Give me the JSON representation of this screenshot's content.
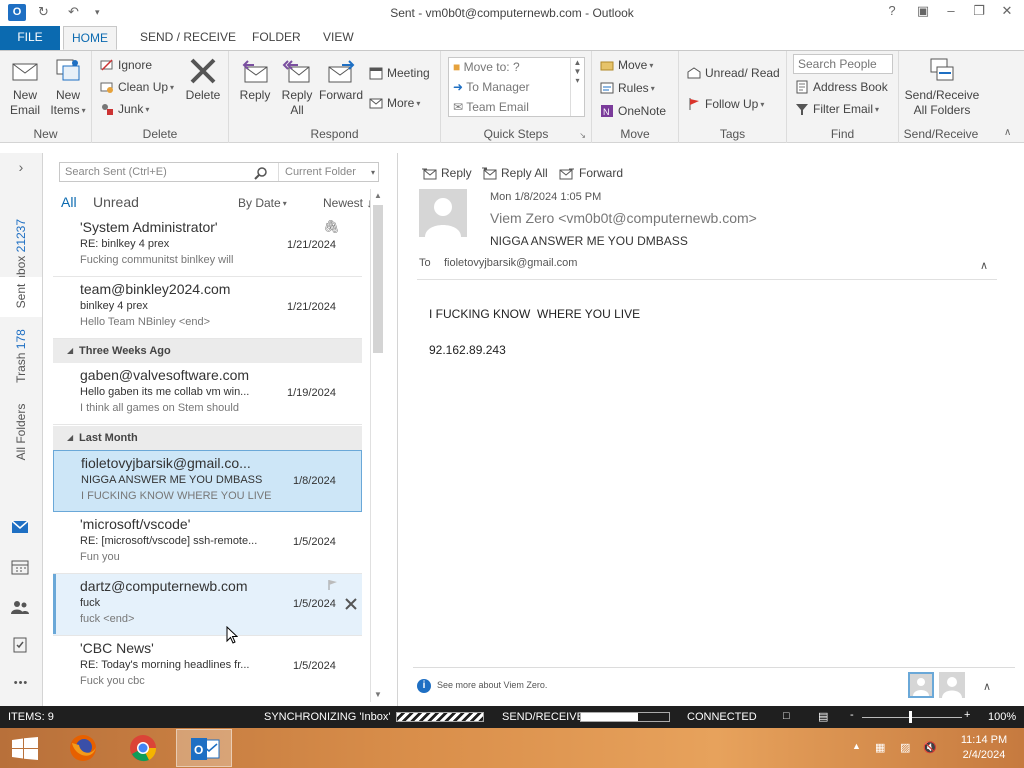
{
  "window": {
    "title": "Sent - vm0b0t@computernewb.com - Outlook",
    "help_label": "?"
  },
  "ribbon_tabs": [
    "FILE",
    "HOME",
    "SEND / RECEIVE",
    "FOLDER",
    "VIEW"
  ],
  "ribbon": {
    "new": {
      "new_email": "New Email",
      "new_items": "New Items",
      "group": "New"
    },
    "delete": {
      "ignore": "Ignore",
      "clean_up": "Clean Up",
      "junk": "Junk",
      "delete": "Delete",
      "group": "Delete"
    },
    "respond": {
      "reply": "Reply",
      "reply_all": "Reply All",
      "forward": "Forward",
      "meeting": "Meeting",
      "more": "More",
      "group": "Respond"
    },
    "quick_steps": {
      "items": [
        "Move to: ?",
        "To Manager",
        "Team Email"
      ],
      "group": "Quick Steps"
    },
    "move": {
      "move": "Move",
      "rules": "Rules",
      "onenote": "OneNote",
      "group": "Move"
    },
    "tags": {
      "unread_read": "Unread/ Read",
      "follow_up": "Follow Up",
      "group": "Tags"
    },
    "find": {
      "search_people_placeholder": "Search People",
      "address_book": "Address Book",
      "filter_email": "Filter Email",
      "group": "Find"
    },
    "send_receive": {
      "button": "Send/Receive All Folders",
      "group": "Send/Receive"
    }
  },
  "nav": {
    "inbox": {
      "label": "Inbox",
      "count": "21237"
    },
    "sent": {
      "label": "Sent"
    },
    "trash": {
      "label": "Trash",
      "count": "178"
    },
    "all_folders": {
      "label": "All Folders"
    },
    "expand_label": "›",
    "more_label": "•••"
  },
  "list": {
    "search_placeholder": "Search Sent (Ctrl+E)",
    "scope": "Current Folder",
    "filter_all": "All",
    "filter_unread": "Unread",
    "sort_by": "By Date",
    "sort_order": "Newest",
    "groups": {
      "three_weeks": "Three Weeks Ago",
      "last_month": "Last Month"
    },
    "messages": [
      {
        "sender": "'System Administrator'",
        "subject": "RE: binlkey 4 prex",
        "preview": "Fucking communitst binlkey will",
        "date": "1/21/2024"
      },
      {
        "sender": "team@binkley2024.com",
        "subject": "binlkey 4 prex",
        "preview": "Hello Team NBinley <end>",
        "date": "1/21/2024"
      },
      {
        "sender": "gaben@valvesoftware.com",
        "subject": "Hello gaben its me collab vm win...",
        "preview": "I think all games on Stem should",
        "date": "1/19/2024"
      },
      {
        "sender": "fioletovyjbarsik@gmail.co...",
        "subject": "NIGGA ANSWER ME YOU DMBASS",
        "preview": "I FUCKING KNOW  WHERE YOU LIVE",
        "date": "1/8/2024"
      },
      {
        "sender": "'microsoft/vscode'",
        "subject": "RE: [microsoft/vscode] ssh-remote...",
        "preview": "Fun you",
        "date": "1/5/2024"
      },
      {
        "sender": "dartz@computernewb.com",
        "subject": "fuck",
        "preview": "fuck <end>",
        "date": "1/5/2024"
      },
      {
        "sender": "'CBC News'",
        "subject": "RE: Today's morning headlines fr...",
        "preview": "Fuck you cbc",
        "date": "1/5/2024"
      }
    ]
  },
  "reading": {
    "reply": "Reply",
    "reply_all": "Reply All",
    "forward": "Forward",
    "date": "Mon 1/8/2024 1:05 PM",
    "from": "Viem Zero <vm0b0t@computernewb.com>",
    "subject": "NIGGA ANSWER ME YOU DMBASS",
    "to_label": "To",
    "to": "fioletovyjbarsik@gmail.com",
    "body_line1": "I FUCKING KNOW  WHERE YOU LIVE",
    "body_line2": "92.162.89.243",
    "see_more": "See more about Viem Zero."
  },
  "status": {
    "items": "ITEMS: 9",
    "sync": "SYNCHRONIZING  'Inbox'",
    "send_receive": "SEND/RECEIVE",
    "send_receive_progress": 0.65,
    "connected": "CONNECTED",
    "zoom": "100%",
    "zoom_minus": "-",
    "zoom_plus": "+"
  },
  "taskbar": {
    "time": "11:14 PM",
    "date": "2/4/2024"
  },
  "colors": {
    "accent": "#0b6ab0",
    "selected_bg": "#cde6f7",
    "statusbar_bg": "#1f1f1f"
  }
}
